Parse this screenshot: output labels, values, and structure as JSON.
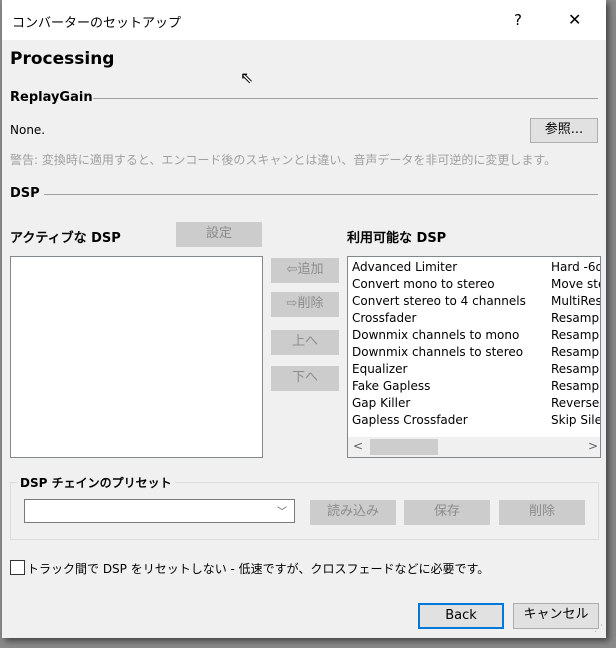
{
  "window": {
    "title": "コンバーターのセットアップ",
    "help": "?",
    "close": "✕"
  },
  "page_title": "Processing",
  "replaygain": {
    "heading": "ReplayGain",
    "value": "None.",
    "browse": "参照...",
    "warning": "警告: 変換時に適用すると、エンコード後のスキャンとは違い、音声データを非可逆的に変更します。"
  },
  "dsp": {
    "heading": "DSP",
    "active_label": "アクティブな DSP",
    "configure": "設定",
    "available_label": "利用可能な DSP",
    "add": "追加",
    "remove": "削除",
    "up": "上へ",
    "down": "下へ",
    "available": [
      [
        "Advanced Limiter",
        "Hard -6d"
      ],
      [
        "Convert mono to stereo",
        "Move ste"
      ],
      [
        "Convert stereo to 4 channels",
        "MultiRes"
      ],
      [
        "Crossfader",
        "Resampl"
      ],
      [
        "Downmix channels to mono",
        "Resampl"
      ],
      [
        "Downmix channels to stereo",
        "Resampl"
      ],
      [
        "Equalizer",
        "Resampl"
      ],
      [
        "Fake Gapless",
        "Resampl"
      ],
      [
        "Gap Killer",
        "Reverse"
      ],
      [
        "Gapless Crossfader",
        "Skip Sile"
      ]
    ],
    "scroll_left": "<",
    "scroll_right": ">"
  },
  "preset": {
    "label": "DSP チェインのプリセット",
    "value": "",
    "load": "読み込み",
    "save": "保存",
    "delete": "削除"
  },
  "option": {
    "checked": false,
    "label": "トラック間で DSP をリセットしない - 低速ですが、クロスフェードなどに必要です。"
  },
  "footer": {
    "back": "Back",
    "cancel": "キャンセル"
  }
}
